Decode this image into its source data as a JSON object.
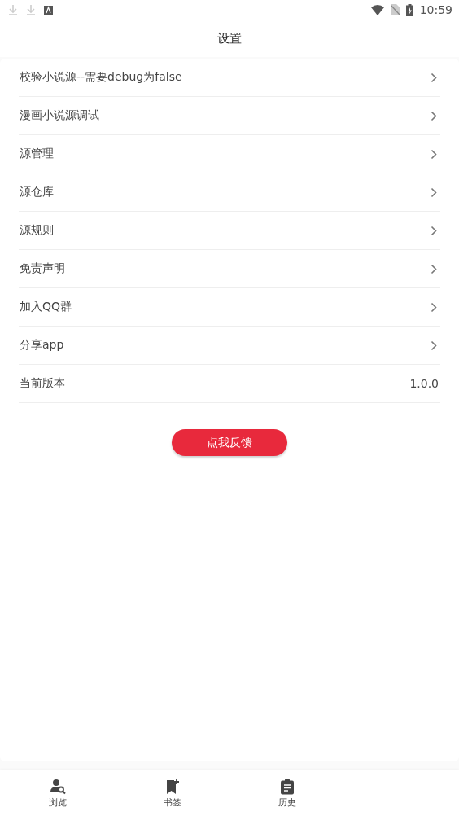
{
  "status_bar": {
    "time": "10:59"
  },
  "title": "设置",
  "settings": [
    {
      "kind": "link",
      "label": "校验小说源--需要debug为false"
    },
    {
      "kind": "link",
      "label": "漫画小说源调试"
    },
    {
      "kind": "link",
      "label": "源管理"
    },
    {
      "kind": "link",
      "label": "源仓库"
    },
    {
      "kind": "link",
      "label": "源规则"
    },
    {
      "kind": "link",
      "label": "免责声明"
    },
    {
      "kind": "link",
      "label": "加入QQ群"
    },
    {
      "kind": "link",
      "label": "分享app"
    },
    {
      "kind": "value",
      "label": "当前版本",
      "value": "1.0.0"
    }
  ],
  "feedback_button": "点我反馈",
  "bottom_nav": [
    {
      "label": "浏览"
    },
    {
      "label": "书签"
    },
    {
      "label": "历史"
    }
  ]
}
